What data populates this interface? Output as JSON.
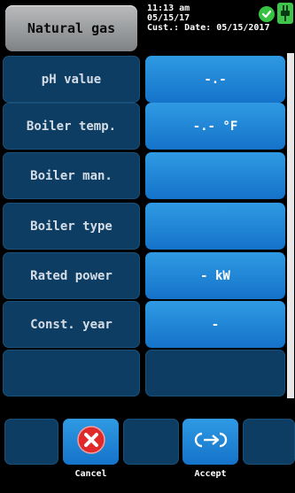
{
  "header": {
    "fuel": "Natural gas",
    "time": "11:13 am",
    "date": "05/15/17",
    "customer": "Cust.: Date: 05/15/2017"
  },
  "rows": [
    {
      "label": "pH value",
      "value": "-.-"
    },
    {
      "label": "Boiler temp.",
      "value": "-.- °F"
    },
    {
      "label": "Boiler man.",
      "value": ""
    },
    {
      "label": "Boiler type",
      "value": ""
    },
    {
      "label": "Rated power",
      "value": "- kW"
    },
    {
      "label": "Const. year",
      "value": "-"
    },
    {
      "label": "",
      "value": ""
    }
  ],
  "footer": {
    "cancel_label": "Cancel",
    "accept_label": "Accept"
  },
  "colors": {
    "accent_blue": "#1e88d8",
    "cell_dark": "#0e3d63",
    "cancel_red": "#e02a2a",
    "status_green": "#37c244"
  }
}
